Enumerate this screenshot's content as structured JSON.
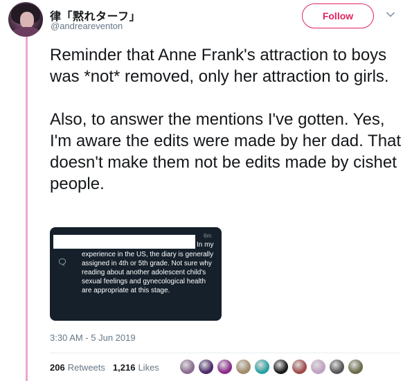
{
  "user": {
    "display_name": "律「黙れターフ」",
    "handle": "@andreareventon"
  },
  "header": {
    "follow_label": "Follow"
  },
  "tweet": {
    "paragraphs": [
      "Reminder that Anne Frank's attraction to boys was *not* removed, only her attraction to girls.",
      "Also, to answer the mentions I've gotten. Yes, I'm aware the edits were made by her dad. That doesn't make them not be edits made by cishet people."
    ],
    "timestamp": "3:30 AM - 5 Jun 2019"
  },
  "embedded_screenshot": {
    "time": "6m",
    "line_fragment": "In my",
    "body": "experience in the US, the diary is generally assigned in 4th or 5th grade. Not sure why reading about another adolescent child's sexual feelings and gynecological health are appropriate at this stage."
  },
  "stats": {
    "retweets_count": "206",
    "retweets_label": "Retweets",
    "likes_count": "1,216",
    "likes_label": "Likes"
  },
  "liker_colors": [
    "#8a6a8f",
    "#4a2a6a",
    "#8a2a8a",
    "#a08a6a",
    "#2aa0a0",
    "#1a1a1a",
    "#a04a4a",
    "#c0a0c0",
    "#555555",
    "#6a6a4a"
  ],
  "colors": {
    "accent": "#e0245e",
    "thread_line": "#e8a7cf",
    "secondary_text": "#657786"
  }
}
